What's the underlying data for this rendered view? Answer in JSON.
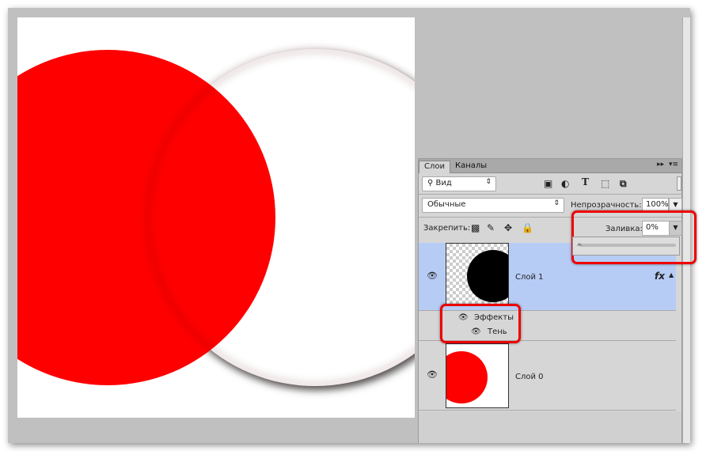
{
  "tabs": {
    "layers": "Слои",
    "channels": "Каналы",
    "collapse": "▸▸",
    "menu": "▾≡"
  },
  "filter": {
    "value": "Вид"
  },
  "blend": {
    "value": "Обычные"
  },
  "opacity": {
    "label": "Непрозрачность:",
    "value": "100%"
  },
  "lock": {
    "label": "Закрепить:"
  },
  "fill": {
    "label": "Заливка:",
    "value": "0%",
    "slider_percent": 0
  },
  "layers": [
    {
      "name": "Слой 1",
      "fx": "fx",
      "effects_label": "Эффекты",
      "effect": "Тень"
    },
    {
      "name": "Слой 0"
    }
  ],
  "colors": {
    "accent": "#ff0000",
    "selected": "#b6ccf5",
    "highlight": "#e00000"
  }
}
